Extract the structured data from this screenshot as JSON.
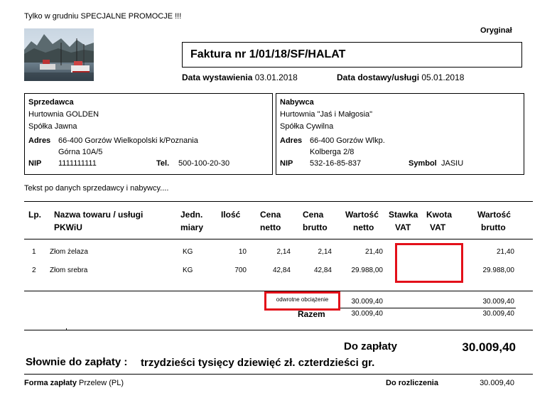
{
  "promo": "Tylko w grudniu SPECJALNE PROMOCJE !!!",
  "copy_label": "Oryginał",
  "invoice_title": "Faktura nr 1/01/18/SF/HALAT",
  "issue_date": {
    "label": "Data wystawienia",
    "value": "03.01.2018"
  },
  "delivery_date": {
    "label": "Data dostawy/usługi",
    "value": "05.01.2018"
  },
  "seller": {
    "heading": "Sprzedawca",
    "name1": "Hurtownia GOLDEN",
    "name2": "Spółka Jawna",
    "address_label": "Adres",
    "address1": "66-400  Gorzów Wielkopolski k/Poznania",
    "address2": "Górna 10A/5",
    "nip_label": "NIP",
    "nip": "1111111111",
    "tel_label": "Tel.",
    "tel": "500-100-20-30"
  },
  "buyer": {
    "heading": "Nabywca",
    "name1": "Hurtownia \"Jaś i Małgosia\"",
    "name2": "Spółka Cywilna",
    "address_label": "Adres",
    "address1": "66-400  Gorzów Wlkp.",
    "address2": "Kolberga 2/8",
    "nip_label": "NIP",
    "nip": "532-16-85-837",
    "symbol_label": "Symbol",
    "symbol": "JASIU"
  },
  "note": "Tekst po danych sprzedawcy i nabywcy....",
  "columns": {
    "lp": "Lp.",
    "name1": "Nazwa towaru / usługi",
    "name2": "PKWiU",
    "unit1": "Jedn.",
    "unit2": "miary",
    "qty": "Ilość",
    "net_price1": "Cena",
    "net_price2": "netto",
    "gross_price1": "Cena",
    "gross_price2": "brutto",
    "net_value1": "Wartość",
    "net_value2": "netto",
    "vat_rate1": "Stawka",
    "vat_rate2": "VAT",
    "vat_amount1": "Kwota",
    "vat_amount2": "VAT",
    "gross_value1": "Wartość",
    "gross_value2": "brutto"
  },
  "rows": [
    {
      "lp": "1",
      "name": "Złom żelaza",
      "unit": "KG",
      "qty": "10",
      "net_price": "2,14",
      "gross_price": "2,14",
      "net_value": "21,40",
      "gross_value": "21,40"
    },
    {
      "lp": "2",
      "name": "Złom srebra",
      "unit": "KG",
      "qty": "700",
      "net_price": "42,84",
      "gross_price": "42,84",
      "net_value": "29.988,00",
      "gross_value": "29.988,00"
    }
  ],
  "summary": {
    "reverse_charge": "odwrotne obciążenie",
    "sub_net": "30.009,40",
    "sub_gross": "30.009,40",
    "total_label": "Razem",
    "total_net": "30.009,40",
    "total_gross": "30.009,40"
  },
  "to_pay": {
    "label": "Do zapłaty",
    "value": "30.009,40"
  },
  "in_words": {
    "label": "Słownie do zapłaty :",
    "value": "trzydzieści tysięcy dziewięć zł. czterdzieści gr."
  },
  "payment": {
    "label": "Forma zapłaty",
    "value": "Przelew (PL)"
  },
  "settlement": {
    "label": "Do rozliczenia",
    "value": "30.009,40"
  }
}
